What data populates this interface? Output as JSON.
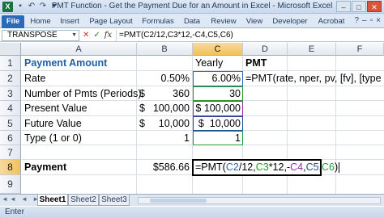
{
  "titlebar": {
    "title": "PMT Function - Get the Payment Due for an Amount in Excel - Microsoft Excel",
    "app_icon": "X",
    "qat_icons": [
      "save-icon",
      "undo-icon",
      "redo-icon",
      "dropdown-icon"
    ],
    "window_buttons": {
      "minimize": "–",
      "maximize": "□",
      "close": "✕"
    }
  },
  "ribbon": {
    "tabs": [
      "File",
      "Home",
      "Insert",
      "Page Layout",
      "Formulas",
      "Data",
      "Review",
      "View",
      "Developer",
      "Acrobat"
    ],
    "right_icons": [
      "help-icon",
      "minimize-ribbon-icon",
      "restore-icon",
      "close-workbook-icon"
    ]
  },
  "formula_bar": {
    "name_box": "TRANSPOSE",
    "cancel_icon": "✕",
    "enter_icon": "✓",
    "fx_label": "fx",
    "formula": "=PMT(C2/12,C3*12,-C4,C5,C6)"
  },
  "columns": [
    "A",
    "B",
    "C",
    "D",
    "E",
    "F"
  ],
  "rows": [
    "1",
    "2",
    "3",
    "4",
    "5",
    "6",
    "7",
    "8",
    "9"
  ],
  "cells": {
    "A1": "Payment Amount",
    "C1": "Yearly",
    "D1": "PMT",
    "A2": "Rate",
    "B2": "0.50%",
    "C2": "6.00%",
    "D2": "=PMT(rate, nper, pv, [fv], [type",
    "A3": "Number of Pmts (Periods)",
    "B3_currency": "$",
    "B3": "360",
    "C3": "30",
    "A4": "Present Value",
    "B4_currency": "$",
    "B4": "100,000",
    "C4": "$ 100,000",
    "A5": "Future Value",
    "B5_currency": "$",
    "B5": "10,000",
    "C5": "$  10,000",
    "A6": "Type (1 or 0)",
    "B6": "1",
    "C6": "1",
    "A8": "Payment",
    "B8": "$586.66",
    "C8_parts": {
      "p0": "=PMT(",
      "p1": "C2",
      "p2": "/12,",
      "p3": "C3",
      "p4": "*12,-",
      "p5": "C4",
      "p6": ",",
      "p7": "C5",
      "p8": ",",
      "p9": "C6",
      "p10": ")"
    }
  },
  "reference_colors": {
    "C2": "#2a6ab8",
    "C3": "#2a9a2a",
    "C4": "#9b2fa8",
    "C5": "#1f4e99",
    "C6": "#1f9e3a"
  },
  "sheets": [
    "Sheet1",
    "Sheet2",
    "Sheet3"
  ],
  "active_sheet": "Sheet1",
  "status": "Enter"
}
